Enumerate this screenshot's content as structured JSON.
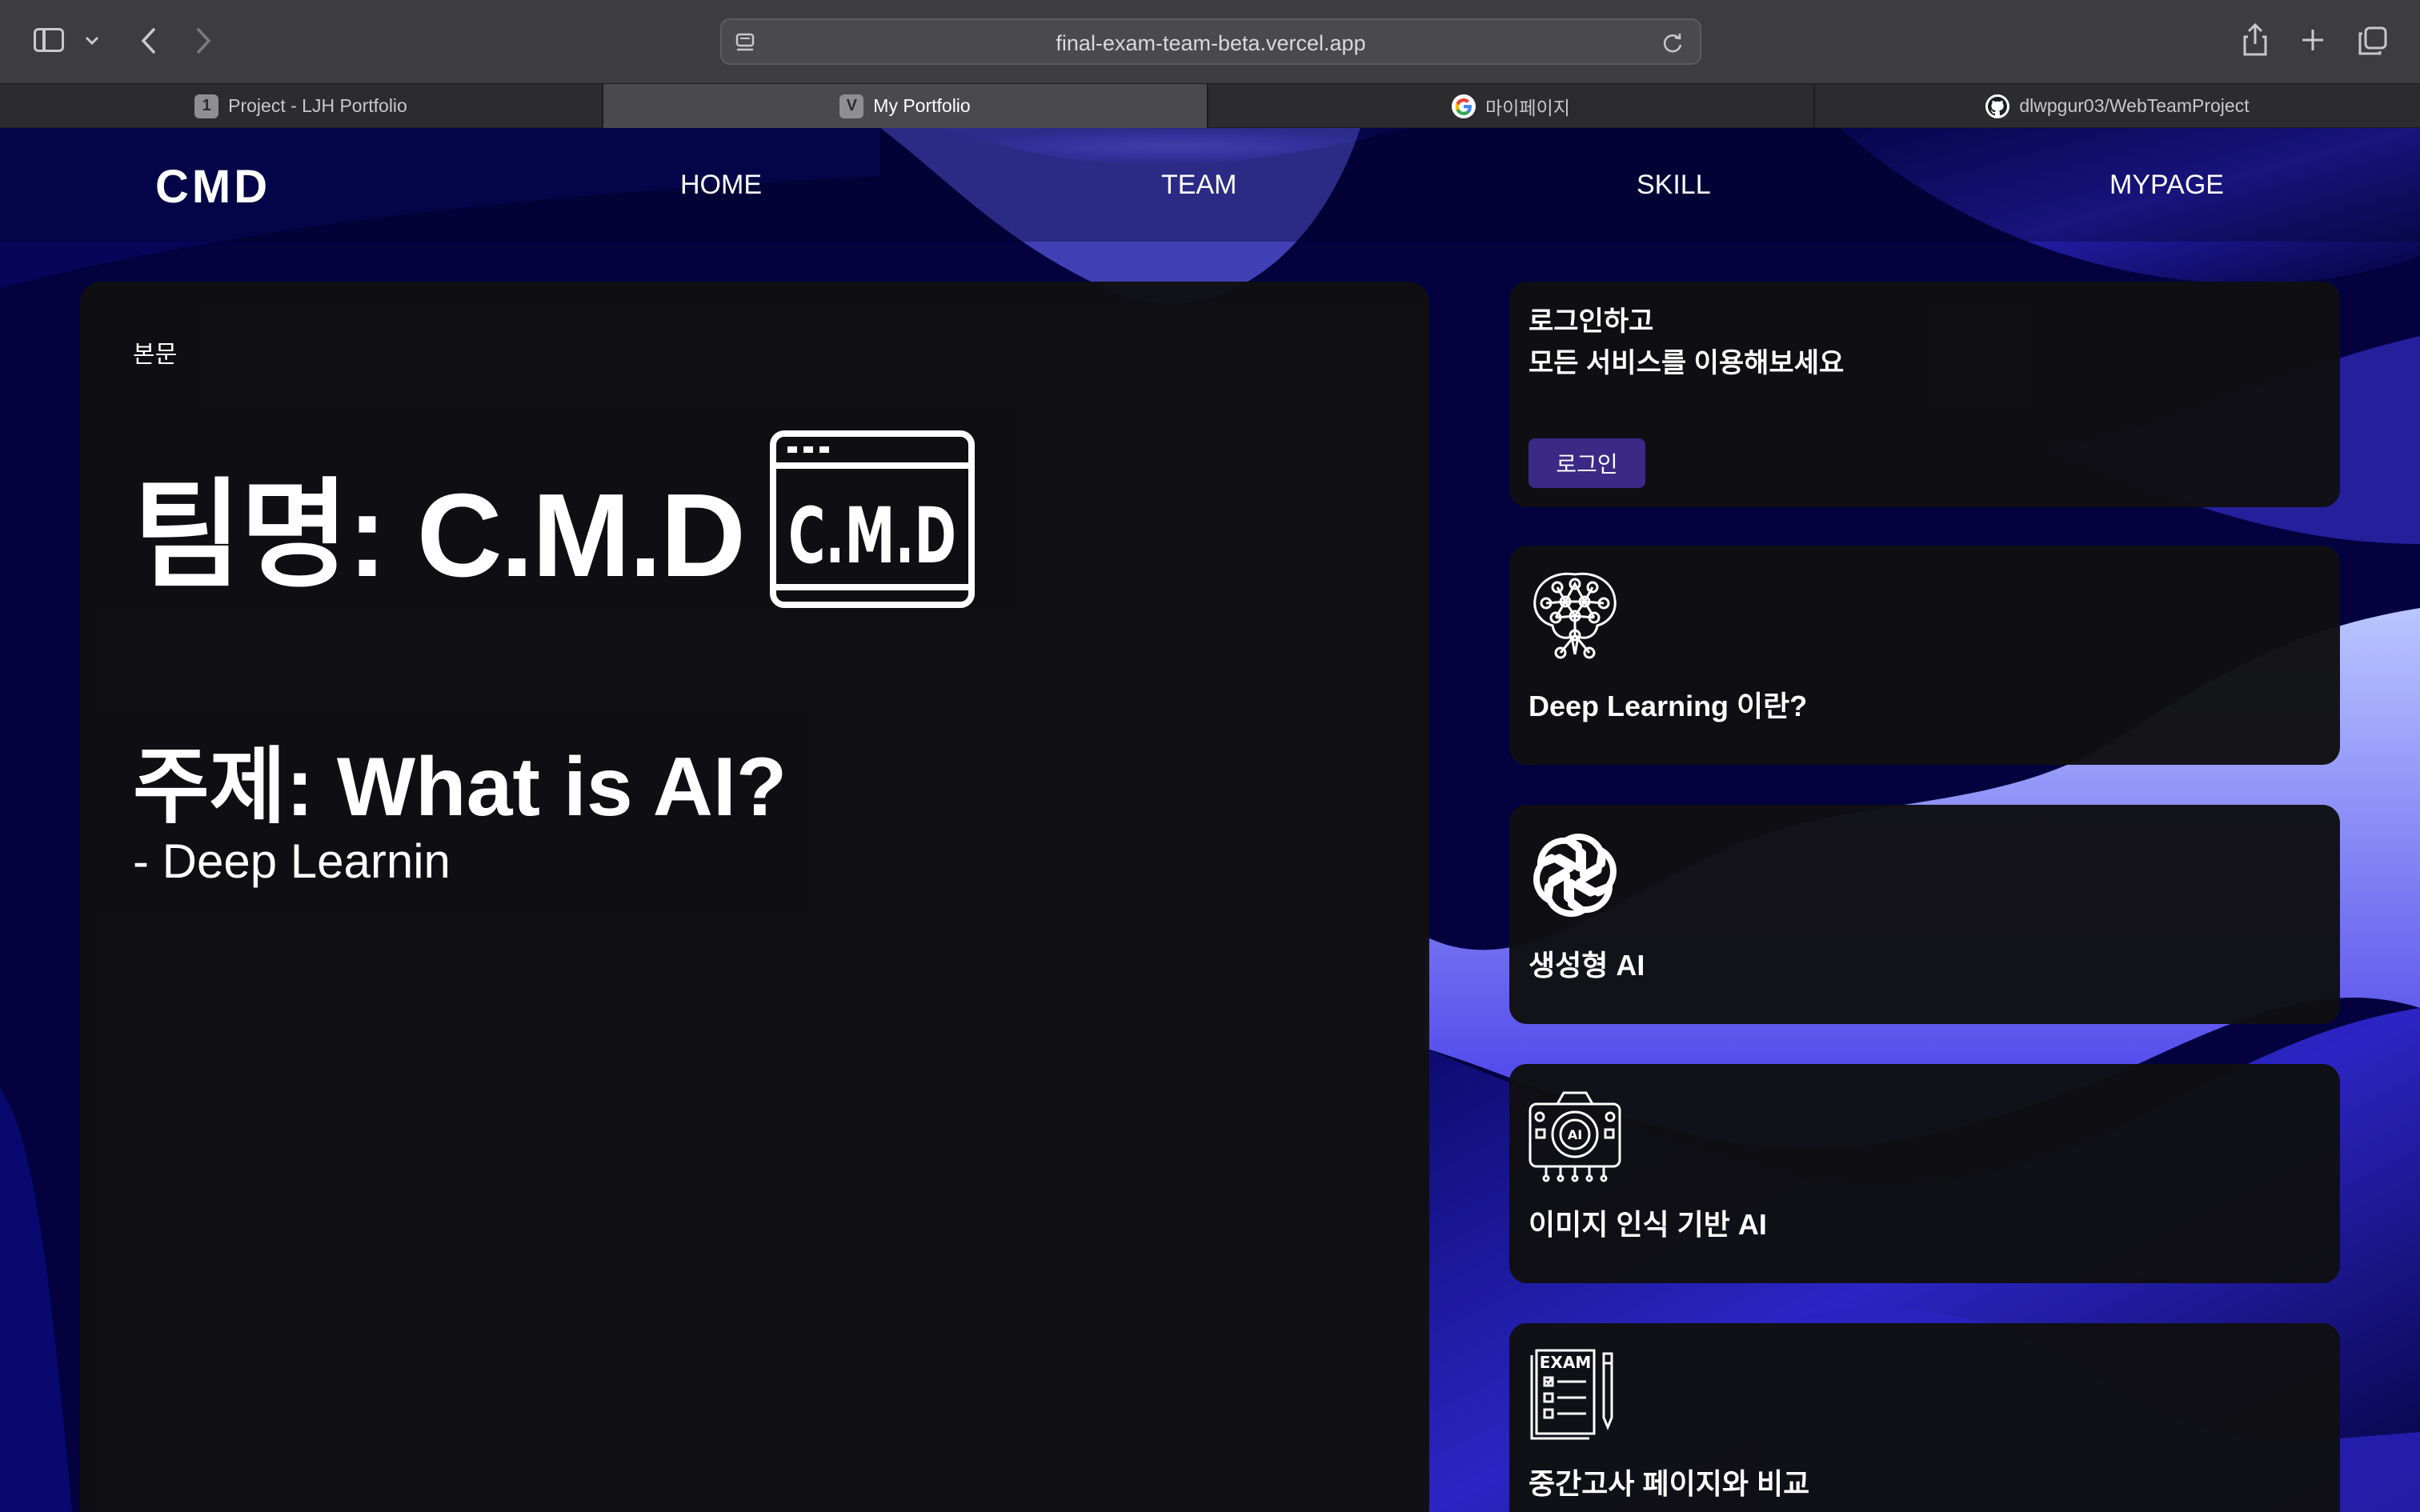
{
  "browser": {
    "url": "final-exam-team-beta.vercel.app",
    "tabs": [
      {
        "label": "Project - LJH Portfolio",
        "favicon": "1"
      },
      {
        "label": "My Portfolio",
        "favicon": "V"
      },
      {
        "label": "마이페이지",
        "favicon": "google-icon"
      },
      {
        "label": "dlwpgur03/WebTeamProject",
        "favicon": "github-icon"
      }
    ]
  },
  "header": {
    "logo": "CMD",
    "nav": [
      "HOME",
      "TEAM",
      "SKILL",
      "MYPAGE"
    ]
  },
  "main": {
    "section_label": "본문",
    "team_title": "팀명: C.M.D",
    "logo_text": "C.M.D",
    "topic_title": "주제: What is AI?",
    "topic_sub": "- Deep Learnin"
  },
  "login": {
    "line1": "로그인하고",
    "line2": "모든 서비스를 이용해보세요",
    "button": "로그인"
  },
  "features": [
    {
      "title": "Deep Learning 이란?",
      "icon": "brain-network-icon"
    },
    {
      "title": "생성형 AI",
      "icon": "openai-icon"
    },
    {
      "title": "이미지 인식 기반 AI",
      "icon": "ai-camera-icon"
    },
    {
      "title": "중간고사 페이지와 비교",
      "icon": "exam-icon"
    }
  ],
  "colors": {
    "background": "#02003a",
    "card": "#101012",
    "accent": "#3a2a86",
    "wave": "#4a3fe0"
  }
}
